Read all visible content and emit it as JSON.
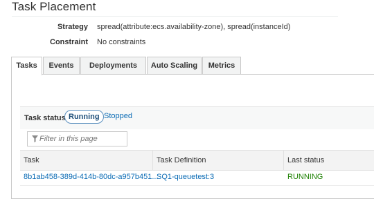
{
  "section": {
    "title": "Task Placement"
  },
  "placement": {
    "strategy_label": "Strategy",
    "strategy_value": "spread(attribute:ecs.availability-zone), spread(instanceId)",
    "constraint_label": "Constraint",
    "constraint_value": "No constraints"
  },
  "tabs": [
    {
      "label": "Tasks",
      "active": true
    },
    {
      "label": "Events",
      "active": false
    },
    {
      "label": "Deployments",
      "active": false
    },
    {
      "label": "Auto Scaling",
      "active": false
    },
    {
      "label": "Metrics",
      "active": false
    }
  ],
  "task_status": {
    "label": "Task status:",
    "options": [
      "Running",
      "Stopped"
    ],
    "selected": "Running"
  },
  "filter": {
    "placeholder": "Filter in this page"
  },
  "table": {
    "columns": [
      "Task",
      "Task Definition",
      "Last status"
    ],
    "rows": [
      {
        "task": "8b1ab458-389d-414b-80dc-a957b451...",
        "task_definition": "SQ1-queuetest:3",
        "last_status": "RUNNING"
      }
    ]
  },
  "colors": {
    "link": "#0a6bb5",
    "status_running": "#1d8102",
    "tab_border": "#c8c8c8"
  },
  "icons": {
    "filter": "filter-icon"
  }
}
